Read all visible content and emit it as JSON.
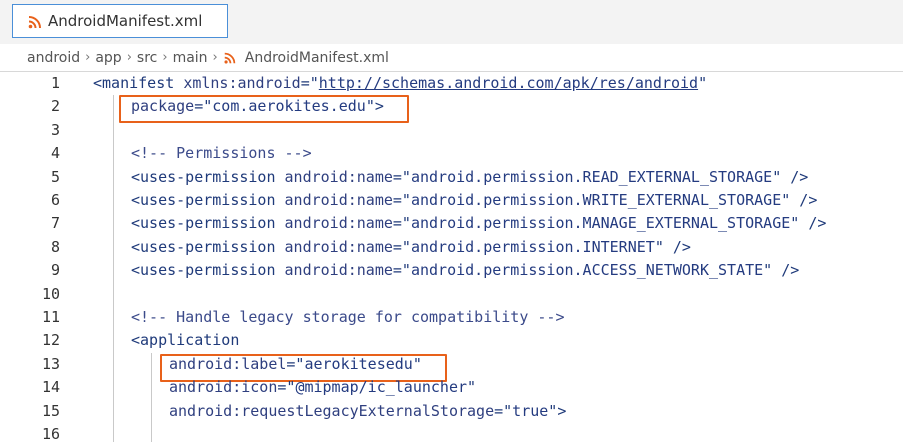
{
  "tab": {
    "label": "AndroidManifest.xml",
    "icon": "rss-xml-icon"
  },
  "breadcrumb": [
    "android",
    "app",
    "src",
    "main",
    "AndroidManifest.xml"
  ],
  "colors": {
    "tab_border": "#4a8fd8",
    "highlight": "#e8611a",
    "xml_icon": "#e8611a"
  },
  "lines": [
    {
      "n": "1",
      "parts": [
        [
          "tag",
          "<manifest "
        ],
        [
          "attr",
          "xmlns:android"
        ],
        [
          "tag",
          "=\""
        ],
        [
          "link",
          "http://schemas.android.com/apk/res/android"
        ],
        [
          "tag",
          "\""
        ]
      ]
    },
    {
      "n": "2",
      "parts": [
        [
          "attr",
          "package"
        ],
        [
          "tag",
          "=\""
        ],
        [
          "str",
          "com.aerokites.edu"
        ],
        [
          "tag",
          "\">"
        ]
      ]
    },
    {
      "n": "3",
      "parts": []
    },
    {
      "n": "4",
      "parts": [
        [
          "com",
          "<!-- Permissions -->"
        ]
      ]
    },
    {
      "n": "5",
      "parts": [
        [
          "tag",
          "<uses-permission "
        ],
        [
          "attr",
          "android:name"
        ],
        [
          "tag",
          "=\""
        ],
        [
          "str",
          "android.permission.READ_EXTERNAL_STORAGE"
        ],
        [
          "tag",
          "\" />"
        ]
      ]
    },
    {
      "n": "6",
      "parts": [
        [
          "tag",
          "<uses-permission "
        ],
        [
          "attr",
          "android:name"
        ],
        [
          "tag",
          "=\""
        ],
        [
          "str",
          "android.permission.WRITE_EXTERNAL_STORAGE"
        ],
        [
          "tag",
          "\" />"
        ]
      ]
    },
    {
      "n": "7",
      "parts": [
        [
          "tag",
          "<uses-permission "
        ],
        [
          "attr",
          "android:name"
        ],
        [
          "tag",
          "=\""
        ],
        [
          "str",
          "android.permission.MANAGE_EXTERNAL_STORAGE"
        ],
        [
          "tag",
          "\" />"
        ]
      ]
    },
    {
      "n": "8",
      "parts": [
        [
          "tag",
          "<uses-permission "
        ],
        [
          "attr",
          "android:name"
        ],
        [
          "tag",
          "=\""
        ],
        [
          "str",
          "android.permission.INTERNET"
        ],
        [
          "tag",
          "\" />"
        ]
      ]
    },
    {
      "n": "9",
      "parts": [
        [
          "tag",
          "<uses-permission "
        ],
        [
          "attr",
          "android:name"
        ],
        [
          "tag",
          "=\""
        ],
        [
          "str",
          "android.permission.ACCESS_NETWORK_STATE"
        ],
        [
          "tag",
          "\" />"
        ]
      ]
    },
    {
      "n": "10",
      "parts": []
    },
    {
      "n": "11",
      "parts": [
        [
          "com",
          "<!-- Handle legacy storage for compatibility -->"
        ]
      ]
    },
    {
      "n": "12",
      "parts": [
        [
          "tag",
          "<application"
        ]
      ]
    },
    {
      "n": "13",
      "parts": [
        [
          "attr",
          "android:label"
        ],
        [
          "tag",
          "=\""
        ],
        [
          "str",
          "aerokitesedu"
        ],
        [
          "tag",
          "\""
        ]
      ]
    },
    {
      "n": "14",
      "parts": [
        [
          "attr",
          "android:icon"
        ],
        [
          "tag",
          "=\""
        ],
        [
          "str",
          "@mipmap/ic_launcher"
        ],
        [
          "tag",
          "\""
        ]
      ]
    },
    {
      "n": "15",
      "parts": [
        [
          "attr",
          "android:requestLegacyExternalStorage"
        ],
        [
          "tag",
          "=\""
        ],
        [
          "str",
          "true"
        ],
        [
          "tag",
          "\">"
        ]
      ]
    },
    {
      "n": "16",
      "parts": []
    }
  ]
}
